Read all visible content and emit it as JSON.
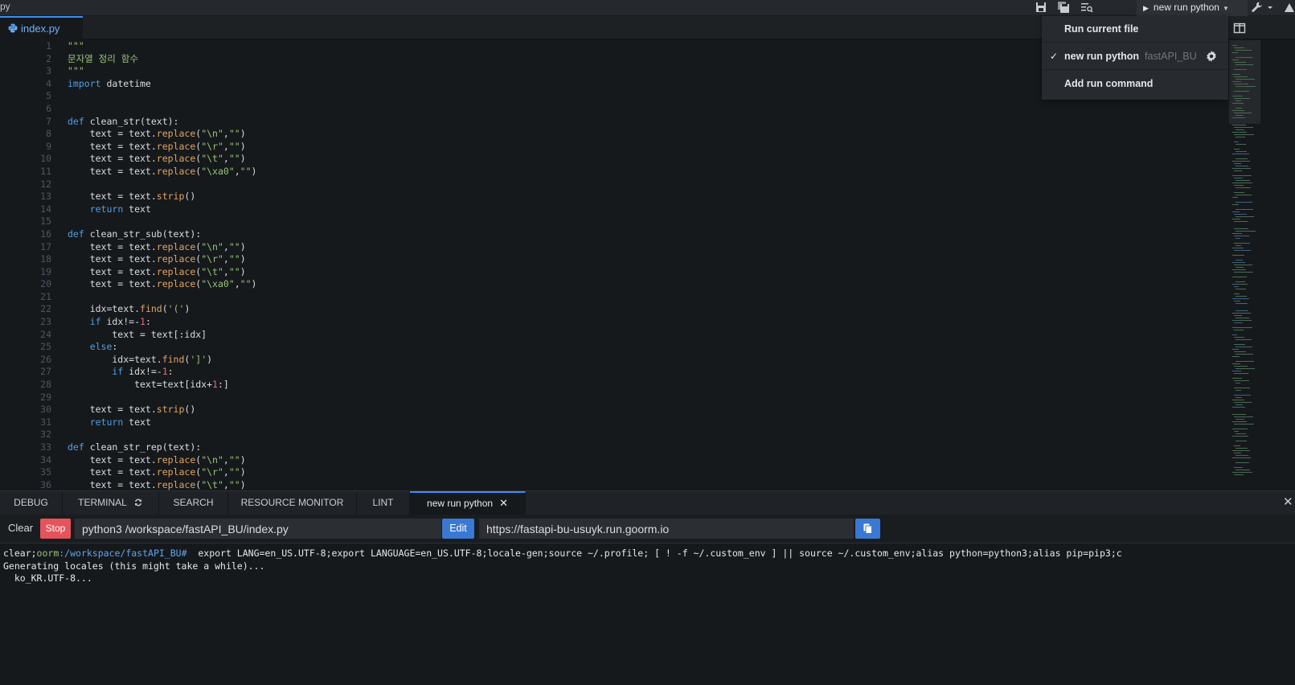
{
  "window": {
    "title_fragment": "py"
  },
  "toolbar": {
    "run_selector_label": "new run python"
  },
  "editor": {
    "tab_label": "index.py",
    "line_numbers": [
      "1",
      "2",
      "3",
      "4",
      "5",
      "6",
      "7",
      "8",
      "9",
      "10",
      "11",
      "12",
      "13",
      "14",
      "15",
      "16",
      "17",
      "18",
      "19",
      "20",
      "21",
      "22",
      "23",
      "24",
      "25",
      "26",
      "27",
      "28",
      "29",
      "30",
      "31",
      "32",
      "33",
      "34",
      "35",
      "36"
    ]
  },
  "run_menu": {
    "items": [
      {
        "label": "Run current file"
      },
      {
        "label": "new run python",
        "sub": "fastAPI_BU",
        "checked": true
      },
      {
        "label": "Add run command"
      }
    ]
  },
  "panel": {
    "tabs": [
      "DEBUG",
      "TERMINAL",
      "SEARCH",
      "RESOURCE MONITOR",
      "LINT",
      "new run python"
    ],
    "active_tab": "new run python"
  },
  "run_toolbar": {
    "clear_label": "Clear",
    "stop_label": "Stop",
    "command_value": "python3 /workspace/fastAPI_BU/index.py",
    "edit_label": "Edit",
    "url_value": "https://fastapi-bu-usuyk.run.goorm.io"
  },
  "terminal": {
    "prompt_prefix": "clear;",
    "prompt_host": "oorm",
    "prompt_path": ":/workspace/fastAPI_BU#",
    "prompt_command": "  export LANG=en_US.UTF-8;export LANGUAGE=en_US.UTF-8;locale-gen;source ~/.profile; [ ! -f ~/.custom_env ] || source ~/.custom_env;alias python=python3;alias pip=pip3;c",
    "lines": [
      "Generating locales (this might take a while)...",
      "  ko_KR.UTF-8..."
    ]
  },
  "colors": {
    "accent": "#3d8ef0",
    "stop": "#e5535b",
    "button_blue": "#3979d4",
    "string": "#98c379",
    "keyword": "#4f9fe8"
  }
}
